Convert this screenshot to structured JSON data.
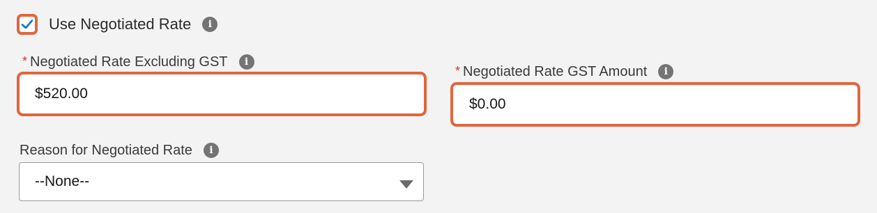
{
  "use_negotiated_rate": {
    "checked": true,
    "label": "Use Negotiated Rate",
    "info_icon": "info-icon"
  },
  "rate_excluding_gst": {
    "required_marker": "*",
    "label": "Negotiated Rate Excluding GST",
    "value": "$520.00",
    "info_icon": "info-icon"
  },
  "gst_amount": {
    "required_marker": "*",
    "label": "Negotiated Rate GST Amount",
    "value": "$0.00",
    "info_icon": "info-icon"
  },
  "reason": {
    "label": "Reason for Negotiated Rate",
    "selected": "--None--",
    "info_icon": "info-icon",
    "arrow_icon": "chevron-down-icon"
  },
  "colors": {
    "highlight_border": "#e0663f",
    "checkmark": "#0176d3",
    "required": "#c23934",
    "info_icon_bg": "#747474",
    "background": "#f3f3f3"
  }
}
